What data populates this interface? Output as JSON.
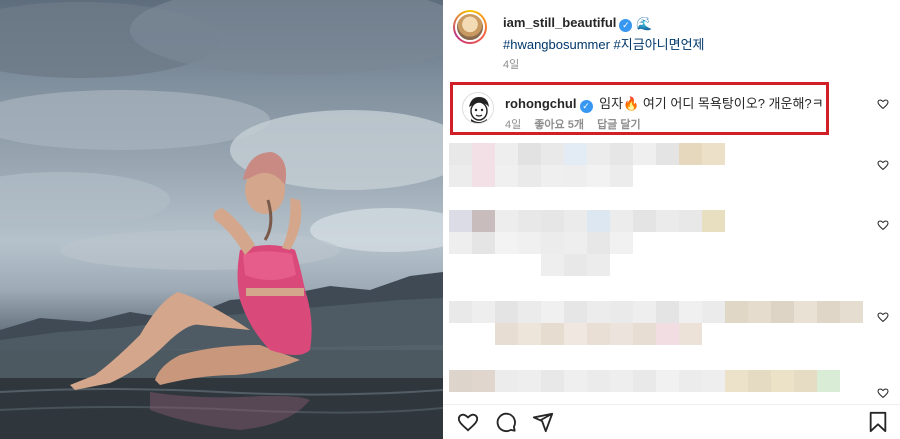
{
  "post": {
    "author": "iam_still_beautiful",
    "author_emoji": "🌊",
    "hashtags": "#hwangbosummer #지금아니면언제",
    "time": "4일"
  },
  "highlighted_comment": {
    "author": "rohongchul",
    "text": "임자🔥 여기 어디 목욕탕이오? 개운해?ㅋ",
    "time": "4일",
    "likes_label": "좋아요",
    "likes_count": "5개",
    "reply_label": "답글 달기"
  },
  "icons": {
    "verified": "verified-icon",
    "like": "heart-icon",
    "comment": "comment-icon",
    "share": "share-icon",
    "save": "bookmark-icon"
  },
  "colors": {
    "link": "#00376b",
    "verified": "#3897f0",
    "highlight_border": "#d11f27",
    "muted": "#8e8e8e"
  }
}
